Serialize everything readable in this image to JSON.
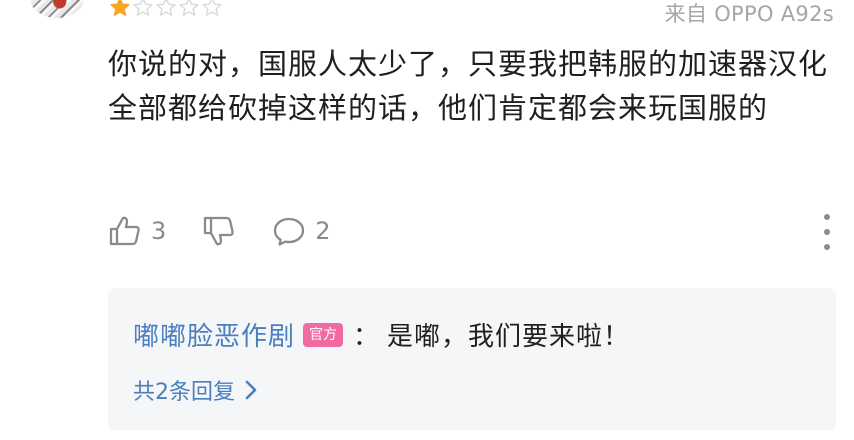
{
  "review": {
    "rating": 1,
    "rating_max": 5,
    "device": "来自 OPPO A92s",
    "text": "你说的对，国服人太少了，只要我把韩服的加速器汉化全部都给砍掉这样的话，他们肯定都会来玩国服的"
  },
  "actions": {
    "likes": "3",
    "comments": "2"
  },
  "reply": {
    "username": "嘟嘟脸恶作剧",
    "badge": "官方",
    "separator": "：",
    "text": "是嘟，我们要来啦！",
    "more_label": "共2条回复"
  },
  "colors": {
    "star_filled": "#f5a623",
    "star_empty": "#d9d9d9",
    "link": "#4a7fbf",
    "badge": "#f16aa1",
    "reply_bg": "#f5f6f8"
  }
}
